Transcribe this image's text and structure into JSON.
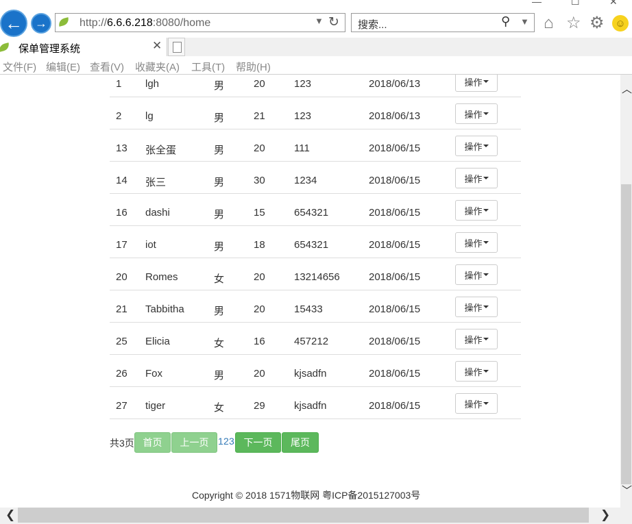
{
  "browser": {
    "address": {
      "prefix": "http://",
      "host": "6.6.6.218",
      "rest": ":8080/home"
    },
    "search_placeholder": "搜索...",
    "tab_title": "保单管理系统",
    "menu": [
      "文件(F)",
      "编辑(E)",
      "查看(V)",
      "收藏夹(A)",
      "工具(T)",
      "帮助(H)"
    ],
    "icons": [
      "back-arrow-icon",
      "forward-arrow-icon",
      "refresh-icon",
      "search-icon",
      "home-icon",
      "star-icon",
      "gear-icon",
      "smiley-icon",
      "tab-close-icon",
      "new-tab-icon"
    ]
  },
  "table": {
    "rows": [
      {
        "id": "1",
        "name": "lgh",
        "sex": "男",
        "age": "20",
        "password": "123",
        "date": "2018/06/13",
        "action": "操作"
      },
      {
        "id": "2",
        "name": "lg",
        "sex": "男",
        "age": "21",
        "password": "123",
        "date": "2018/06/13",
        "action": "操作"
      },
      {
        "id": "13",
        "name": "张全蛋",
        "sex": "男",
        "age": "20",
        "password": "111",
        "date": "2018/06/15",
        "action": "操作"
      },
      {
        "id": "14",
        "name": "张三",
        "sex": "男",
        "age": "30",
        "password": "1234",
        "date": "2018/06/15",
        "action": "操作"
      },
      {
        "id": "16",
        "name": "dashi",
        "sex": "男",
        "age": "15",
        "password": "654321",
        "date": "2018/06/15",
        "action": "操作"
      },
      {
        "id": "17",
        "name": "iot",
        "sex": "男",
        "age": "18",
        "password": "654321",
        "date": "2018/06/15",
        "action": "操作"
      },
      {
        "id": "20",
        "name": "Romes",
        "sex": "女",
        "age": "20",
        "password": "13214656",
        "date": "2018/06/15",
        "action": "操作"
      },
      {
        "id": "21",
        "name": "Tabbitha",
        "sex": "男",
        "age": "20",
        "password": "15433",
        "date": "2018/06/15",
        "action": "操作"
      },
      {
        "id": "25",
        "name": "Elicia",
        "sex": "女",
        "age": "16",
        "password": "457212",
        "date": "2018/06/15",
        "action": "操作"
      },
      {
        "id": "26",
        "name": "Fox",
        "sex": "男",
        "age": "20",
        "password": "kjsadfn",
        "date": "2018/06/15",
        "action": "操作"
      },
      {
        "id": "27",
        "name": "tiger",
        "sex": "女",
        "age": "29",
        "password": "kjsadfn",
        "date": "2018/06/15",
        "action": "操作"
      }
    ]
  },
  "pager": {
    "total": "共3页",
    "first": "首页",
    "prev": "上一页",
    "pages": [
      "1",
      "2",
      "3"
    ],
    "next": "下一页",
    "last": "尾页"
  },
  "footer": "Copyright © 2018  1571物联网  粤ICP备2015127003号"
}
